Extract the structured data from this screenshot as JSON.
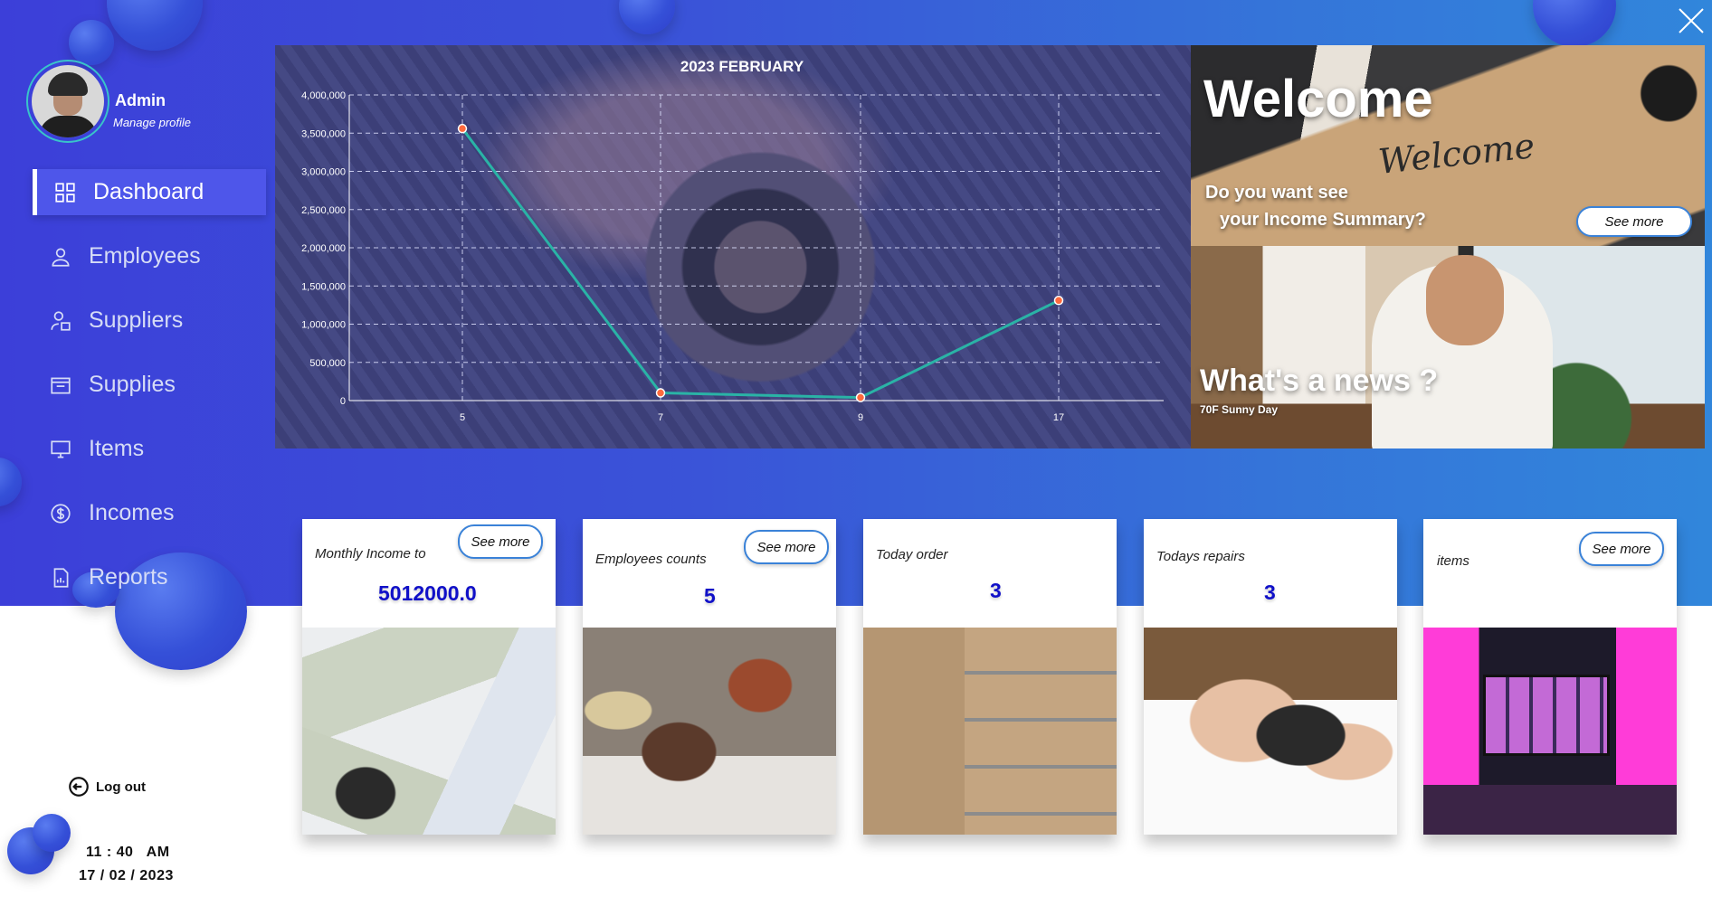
{
  "sidebar": {
    "admin_name": "Admin",
    "manage_profile": "Manage profile",
    "items": [
      {
        "label": "Dashboard",
        "icon": "dashboard-icon",
        "active": true
      },
      {
        "label": "Employees",
        "icon": "user-icon",
        "active": false
      },
      {
        "label": "Suppliers",
        "icon": "supplier-icon",
        "active": false
      },
      {
        "label": "Supplies",
        "icon": "box-icon",
        "active": false
      },
      {
        "label": "Items",
        "icon": "monitor-icon",
        "active": false
      },
      {
        "label": "Incomes",
        "icon": "dollar-icon",
        "active": false
      },
      {
        "label": "Reports",
        "icon": "report-icon",
        "active": false
      }
    ],
    "logout_label": "Log out",
    "time": "11 : 40   AM",
    "date": "17 / 02 / 2023"
  },
  "chart_data": {
    "type": "line",
    "title": "2023  FEBRUARY",
    "x": [
      5,
      7,
      9,
      17
    ],
    "categories": [
      "5",
      "7",
      "9",
      "17"
    ],
    "series": [
      {
        "values": [
          3560000,
          100000,
          40000,
          1310000
        ],
        "color": "#2ab3a6"
      }
    ],
    "yticks": [
      "0",
      "500,000",
      "1,000,000",
      "1,500,000",
      "2,000,000",
      "2,500,000",
      "3,000,000",
      "3,500,000",
      "4,000,000"
    ],
    "ylim": [
      0,
      4000000
    ],
    "grid": true
  },
  "welcome": {
    "title": "Welcome",
    "script_text": "Welcome",
    "question_line1": "Do you want see",
    "question_line2": "your Income Summary?",
    "see_more": "See more"
  },
  "news": {
    "title": "What's a news ?",
    "subtitle": "70F Sunny Day"
  },
  "cards": [
    {
      "label": "Monthly Income to",
      "value": "5012000.0",
      "see_more": "See more"
    },
    {
      "label": "Employees counts",
      "value": "5",
      "see_more": "See more"
    },
    {
      "label": "Today order",
      "value": "3"
    },
    {
      "label": "Todays repairs",
      "value": "3"
    },
    {
      "label": "items",
      "value": "",
      "see_more": "See more"
    }
  ],
  "colors": {
    "banner_start": "#3c3fd9",
    "banner_end": "#3186db",
    "active_nav": "#4e56ea",
    "value_text": "#1010c8",
    "chart_line": "#2ab3a6"
  }
}
